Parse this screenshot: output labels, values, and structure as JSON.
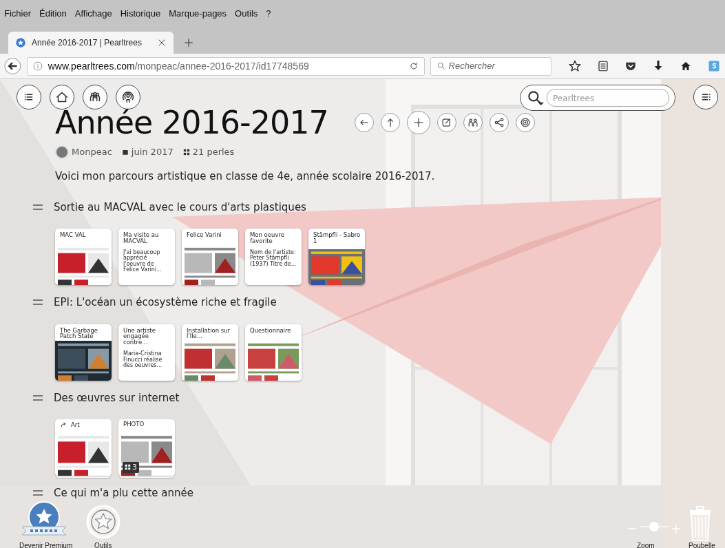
{
  "menu_bar": [
    {
      "label": "Fichier"
    },
    {
      "label": "Édition"
    },
    {
      "label": "Affichage"
    },
    {
      "label": "Historique"
    },
    {
      "label": "Marque-pages"
    },
    {
      "label": "Outils"
    },
    {
      "label": "?"
    }
  ],
  "tabs": [
    {
      "label": "Année 2016-2017 | Pearltrees",
      "selected": true
    }
  ],
  "address_bar": {
    "domain": "www.pearltrees.com",
    "path": "/monpeac/annee-2016-2017/id17748569"
  },
  "search": {
    "placeholder": "Rechercher"
  },
  "site_search": {
    "placeholder": "Pearltrees"
  },
  "page": {
    "title": "Année 2016-2017",
    "author": "Monpeac",
    "date": "juin 2017",
    "count": "21 perles",
    "description": "Voici mon parcours artistique en classe de 4e, année scolaire 2016-2017."
  },
  "sections": [
    {
      "title": "Sortie au MACVAL avec le cours d'arts plastiques",
      "cards": [
        {
          "kind": "page",
          "title": "MAC VAL"
        },
        {
          "kind": "note",
          "title": "Ma visite au MACVAL",
          "text": "J'ai beaucoup apprécié l'oeuvre de Felice Varini..."
        },
        {
          "kind": "page",
          "title": "Felice Varini"
        },
        {
          "kind": "note",
          "title": "Mon oeuvre favorite",
          "text": "Nom de l'artiste: Peter Stämpfli (1937) Titre de..."
        },
        {
          "title": "Stämpfli - Sabro 1"
        }
      ]
    },
    {
      "title": "EPI: L'océan un écosystème riche et fragile",
      "cards": [
        {
          "kind": "page",
          "title": "The Garbage Patch State"
        },
        {
          "kind": "note",
          "title": "Une artiste engagée contre...",
          "text": "Maria-Cristina Finucci réalise des oeuvres..."
        },
        {
          "kind": "page",
          "title": "Installation sur l'Ile..."
        },
        {
          "kind": "page",
          "title": "Questionnaire"
        }
      ]
    },
    {
      "title": "Des œuvres sur internet",
      "cards": [
        {
          "kind": "collection",
          "title": "Art",
          "shared": true
        },
        {
          "kind": "collection",
          "title": "PHOTO",
          "shared": false,
          "count": "3"
        }
      ]
    },
    {
      "title": "Ce qui m'a plu cette année"
    }
  ],
  "bottom_bar": {
    "premium": "Devenir Premium",
    "tools": "Outils",
    "zoom": {
      "label": "Zoom",
      "level": 0.5
    },
    "trash": "Poubelle"
  }
}
